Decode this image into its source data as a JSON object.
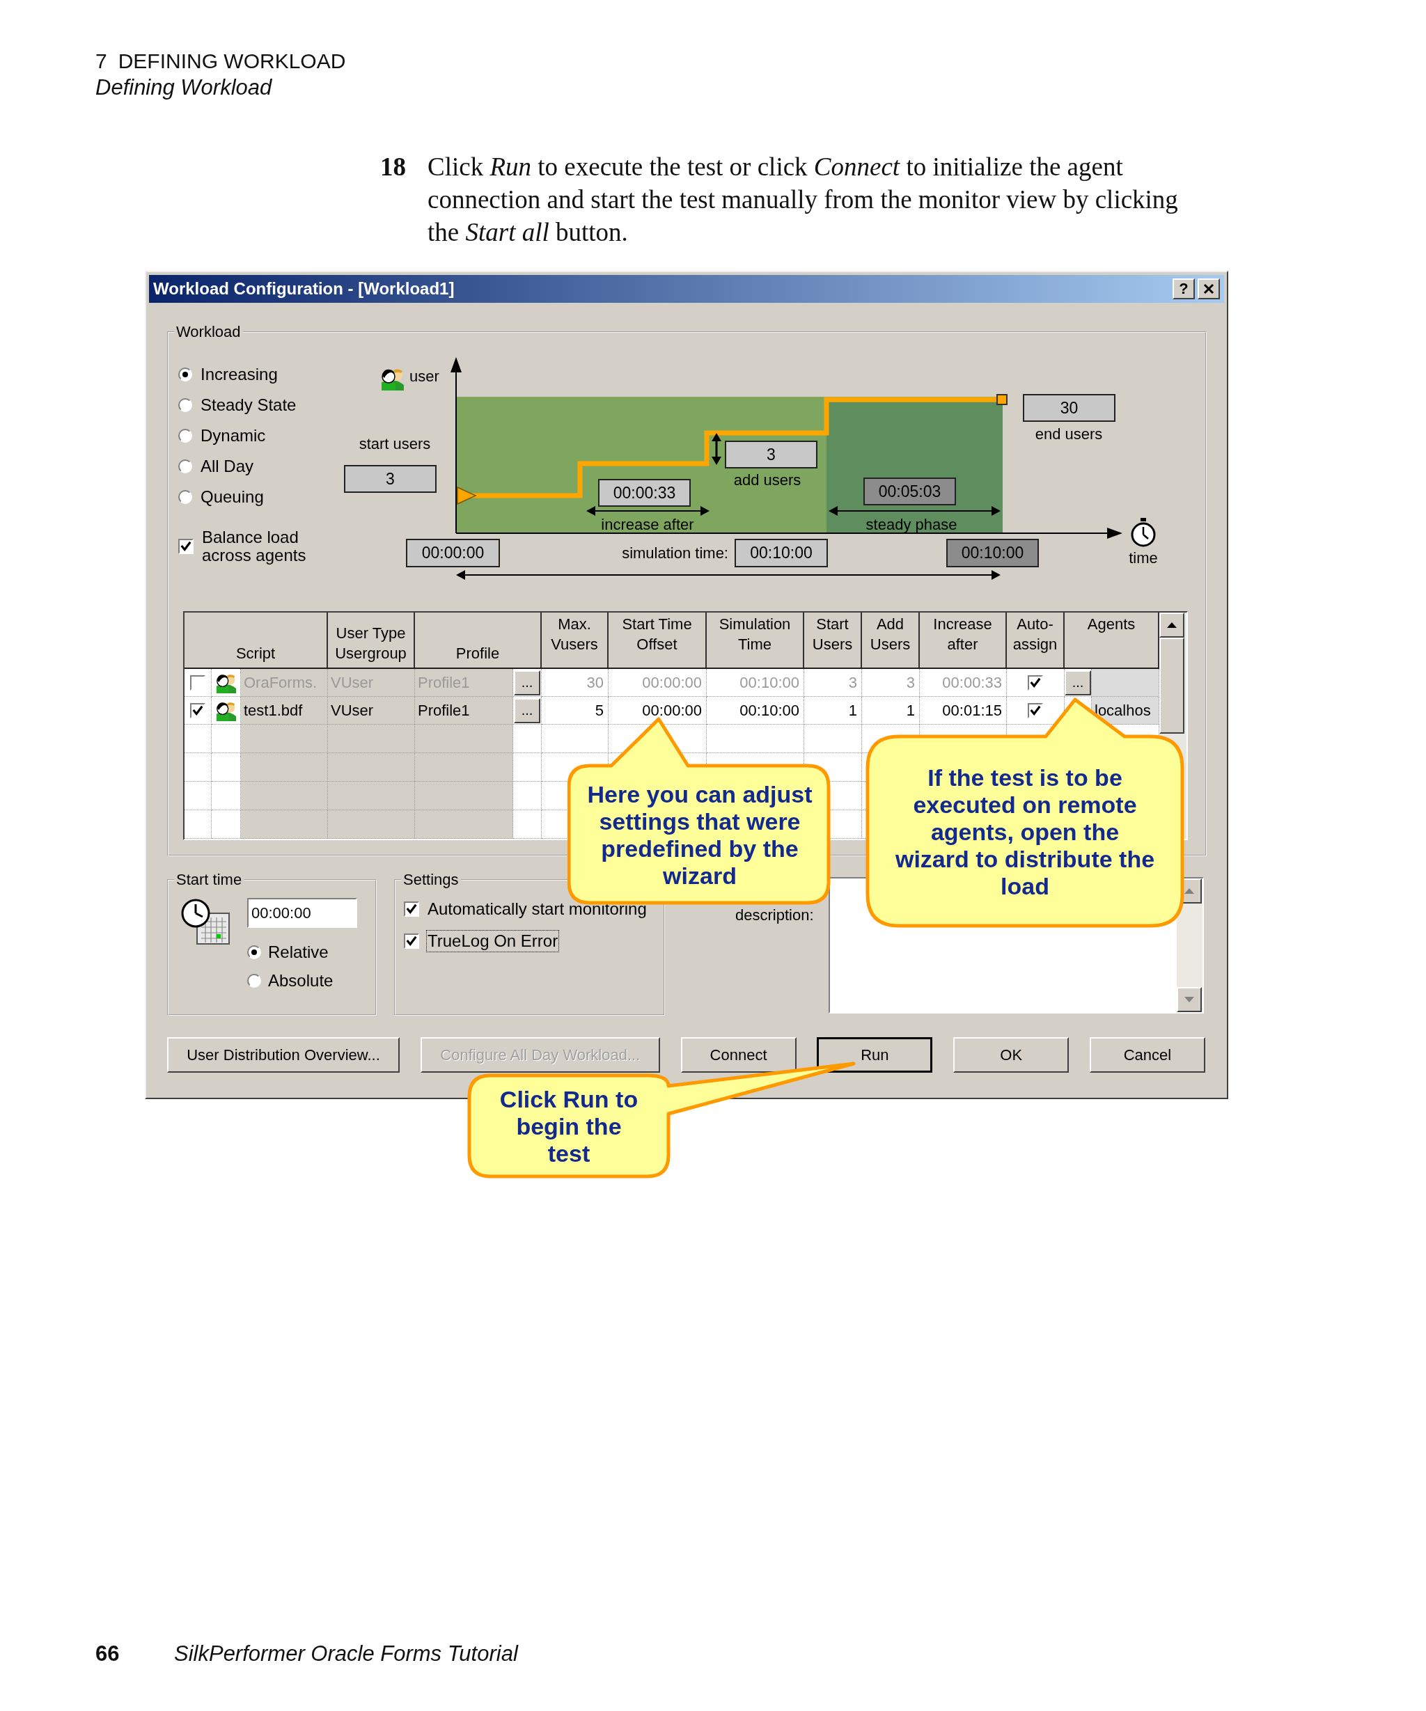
{
  "page_header": {
    "chapter": "7",
    "title": "DEFINING WORKLOAD",
    "subtitle": "Defining Workload"
  },
  "step": {
    "number": "18",
    "text": "Click *Run* to execute the test or click *Connect* to initialize the agent connection and start the test manually from the monitor view by clicking the *Start all* button."
  },
  "dialog": {
    "title": "Workload Configuration - [Workload1]",
    "help_button": "?",
    "workload": {
      "label": "Workload",
      "modes": [
        {
          "label": "Increasing",
          "selected": true
        },
        {
          "label": "Steady State",
          "selected": false
        },
        {
          "label": "Dynamic",
          "selected": false
        },
        {
          "label": "All Day",
          "selected": false
        },
        {
          "label": "Queuing",
          "selected": false
        }
      ],
      "balance": {
        "label": "Balance load across agents",
        "checked": true
      },
      "diagram": {
        "y_label": "user",
        "start_users_label": "start users",
        "start_users": "3",
        "increase_after": "00:00:33",
        "increase_after_label": "increase after",
        "add_users": "3",
        "add_users_label": "add users",
        "steady_phase": "00:05:03",
        "steady_phase_label": "steady phase",
        "end_users": "30",
        "end_users_label": "end users",
        "start_time": "00:00:00",
        "simulation_time_label": "simulation time:",
        "simulation_time": "00:10:00",
        "end_time": "00:10:00",
        "x_label": "time"
      }
    },
    "table": {
      "columns": [
        {
          "label": "Script",
          "kind": "text"
        },
        {
          "label": "Usergroup",
          "group": "User Type",
          "kind": "text"
        },
        {
          "label": "Profile",
          "kind": "text"
        },
        {
          "label": "Max. Vusers",
          "kind": "number"
        },
        {
          "label": "Start Time Offset",
          "kind": "number"
        },
        {
          "label": "Simulation Time",
          "kind": "number"
        },
        {
          "label": "Start Users",
          "kind": "number"
        },
        {
          "label": "Add Users",
          "kind": "number"
        },
        {
          "label": "Increase after",
          "kind": "number"
        },
        {
          "label": "Auto-assign",
          "kind": "check"
        },
        {
          "label": "Agents",
          "kind": "list"
        }
      ],
      "rows": [
        {
          "enabled": false,
          "checked": false,
          "script": "OraForms.",
          "usergroup": "VUser",
          "profile": "Profile1",
          "profile_button": "...",
          "max_vusers": "30",
          "start_offset": "00:00:00",
          "simulation_time": "00:10:00",
          "start_users": "3",
          "add_users": "3",
          "increase_after": "00:00:33",
          "auto_assign": true,
          "agents_button": "..."
        },
        {
          "enabled": true,
          "checked": true,
          "script": "test1.bdf",
          "usergroup": "VUser",
          "profile": "Profile1",
          "profile_button": "...",
          "max_vusers": "5",
          "start_offset": "00:00:00",
          "simulation_time": "00:10:00",
          "start_users": "1",
          "add_users": "1",
          "increase_after": "00:01:15",
          "auto_assign": true,
          "agents": "localhos"
        }
      ]
    },
    "start_time": {
      "label": "Start time",
      "value": "00:00:00",
      "modes": [
        {
          "label": "Relative",
          "selected": true
        },
        {
          "label": "Absolute",
          "selected": false
        }
      ]
    },
    "settings": {
      "label": "Settings",
      "options": [
        {
          "label": "Automatically start monitoring",
          "checked": true,
          "focused": false
        },
        {
          "label": "TrueLog On Error",
          "checked": true,
          "focused": true
        }
      ]
    },
    "description_label": "description:",
    "buttons": [
      {
        "label": "User Distribution Overview...",
        "disabled": false,
        "default": false
      },
      {
        "label": "Configure All Day Workload...",
        "disabled": true,
        "default": false
      },
      {
        "label": "Connect",
        "disabled": false,
        "default": false
      },
      {
        "label": "Run",
        "disabled": false,
        "default": true
      },
      {
        "label": "OK",
        "disabled": false,
        "default": false
      },
      {
        "label": "Cancel",
        "disabled": false,
        "default": false
      }
    ]
  },
  "callouts": [
    {
      "text": "Here you can adjust settings that were predefined by the wizard"
    },
    {
      "text": "If the test is to be executed on remote agents, open the wizard to distribute the load"
    },
    {
      "text": "Click Run to begin the test"
    }
  ],
  "footer": {
    "page_number": "66",
    "title": "SilkPerformer Oracle Forms Tutorial"
  }
}
